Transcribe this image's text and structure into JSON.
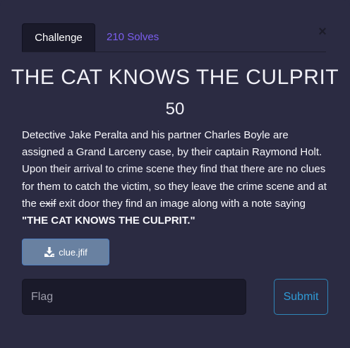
{
  "tabs": {
    "challenge_label": "Challenge",
    "solves_label": "210 Solves"
  },
  "close_icon": "×",
  "challenge": {
    "title": "THE CAT KNOWS THE CULPRIT",
    "points": "50",
    "description": {
      "part1": "Detective Jake Peralta and his partner Charles Boyle are assigned a Grand Larceny case, by their captain Raymond Holt. Upon their arrival to crime scene they find that there are no clues for them to catch the victim, so they leave the crime scene and at the ",
      "strikethrough": "exif",
      "part2": " exit door they find an image along with a note saying ",
      "quote": "\"THE CAT KNOWS THE CULPRIT.\""
    }
  },
  "file": {
    "name": "clue.jfif",
    "icon": "download-icon"
  },
  "flag_input": {
    "placeholder": "Flag",
    "value": ""
  },
  "submit_label": "Submit",
  "colors": {
    "background": "#2b2b42",
    "active_tab": "#1a1a2a",
    "solves_link": "#7b5ef0",
    "file_button": "#6981a1",
    "submit_border": "#2f86b8"
  }
}
